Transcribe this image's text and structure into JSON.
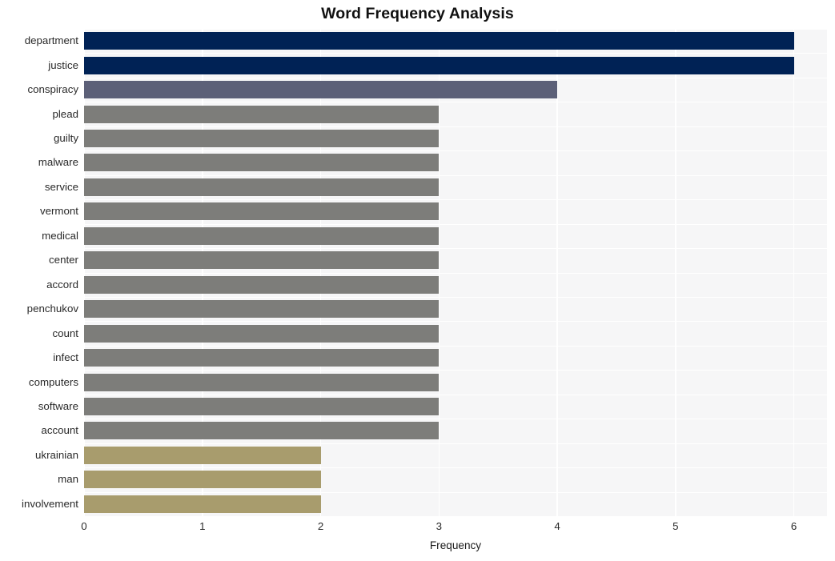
{
  "chart_data": {
    "type": "bar",
    "orientation": "horizontal",
    "title": "Word Frequency Analysis",
    "xlabel": "Frequency",
    "ylabel": "",
    "xlim": [
      0,
      6.28
    ],
    "xticks": [
      0,
      1,
      2,
      3,
      4,
      5,
      6
    ],
    "xtick_labels": [
      "0",
      "1",
      "2",
      "3",
      "4",
      "5",
      "6"
    ],
    "grid": true,
    "legend": null,
    "categories": [
      "department",
      "justice",
      "conspiracy",
      "plead",
      "guilty",
      "malware",
      "service",
      "vermont",
      "medical",
      "center",
      "accord",
      "penchukov",
      "count",
      "infect",
      "computers",
      "software",
      "account",
      "ukrainian",
      "man",
      "involvement"
    ],
    "values": [
      6,
      6,
      4,
      3,
      3,
      3,
      3,
      3,
      3,
      3,
      3,
      3,
      3,
      3,
      3,
      3,
      3,
      2,
      2,
      2
    ],
    "bar_colors": [
      "#002255",
      "#002255",
      "#5c6078",
      "#7d7d7a",
      "#7d7d7a",
      "#7d7d7a",
      "#7d7d7a",
      "#7d7d7a",
      "#7d7d7a",
      "#7d7d7a",
      "#7d7d7a",
      "#7d7d7a",
      "#7d7d7a",
      "#7d7d7a",
      "#7d7d7a",
      "#7d7d7a",
      "#7d7d7a",
      "#a89c6d",
      "#a89c6d",
      "#a89c6d"
    ]
  },
  "style": {
    "plot_background": "#f6f6f7",
    "grid_color": "#ffffff",
    "page_background": "#ffffff",
    "title_color": "#111111",
    "tick_color": "#2a2a2a"
  }
}
